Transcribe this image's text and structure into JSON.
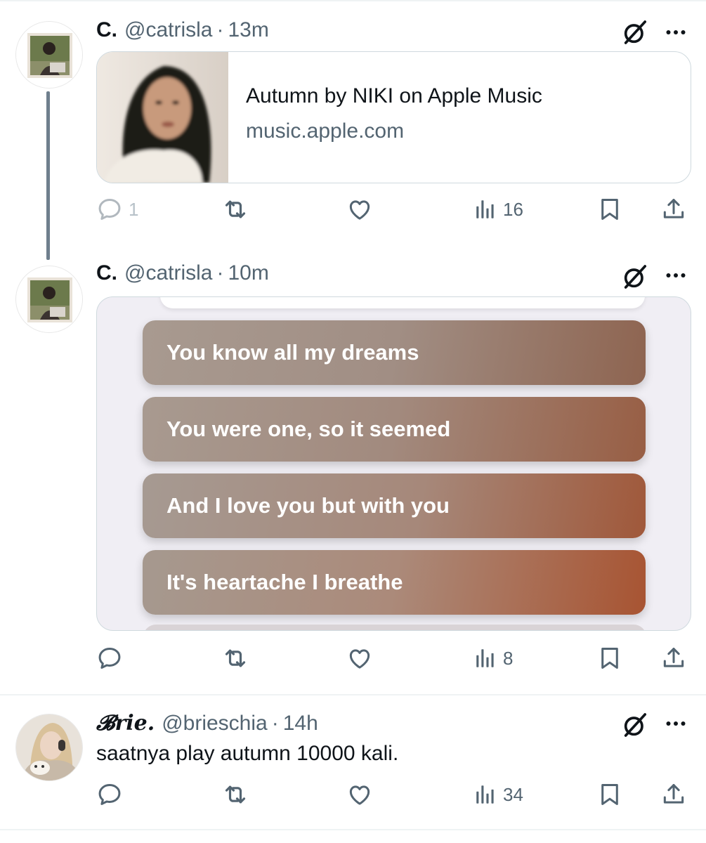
{
  "colors": {
    "text": "#0f1419",
    "muted": "#536471",
    "border": "#cfd9de",
    "thread": "#6f7f8d"
  },
  "tweets": [
    {
      "name": "C.",
      "handle": "@catrisla",
      "dot": "·",
      "time": "13m",
      "card": {
        "title": "Autumn by NIKI on Apple Music",
        "domain": "music.apple.com"
      },
      "actions": {
        "replies": "1",
        "views": "16"
      }
    },
    {
      "name": "C.",
      "handle": "@catrisla",
      "dot": "·",
      "time": "10m",
      "lyrics": [
        "You know all my dreams",
        "You were one, so it seemed",
        "And I love you but with you",
        "It's heartache I breathe"
      ],
      "actions": {
        "views": "8"
      }
    },
    {
      "name": "𝓑rie.",
      "handle": "@brieschia",
      "dot": "·",
      "time": "14h",
      "text": "saatnya play autumn 10000 kali.",
      "actions": {
        "views": "34"
      }
    }
  ],
  "icons": {
    "reply": "reply-icon",
    "retweet": "retweet-icon",
    "like": "heart-icon",
    "views": "views-icon",
    "bookmark": "bookmark-icon",
    "share": "share-icon",
    "grok": "grok-icon",
    "more": "more-icon"
  }
}
